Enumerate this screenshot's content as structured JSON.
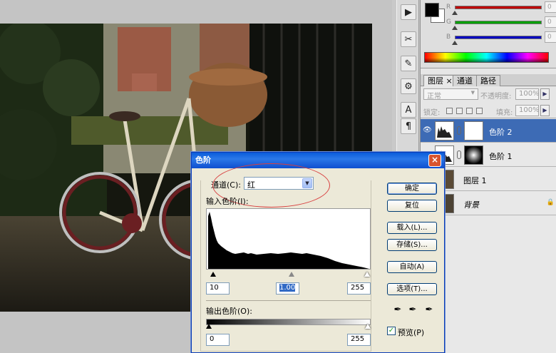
{
  "color_panel": {
    "foreground": "#000000",
    "background": "#ffffff",
    "sliders": [
      {
        "letter": "R",
        "value": "0",
        "color": "#c00000"
      },
      {
        "letter": "G",
        "value": "0",
        "color": "#00a000"
      },
      {
        "letter": "B",
        "value": "0",
        "color": "#0000c0"
      }
    ]
  },
  "layers_panel": {
    "tabs": [
      {
        "label": "图层",
        "close": "×"
      },
      {
        "label": "通道"
      },
      {
        "label": "路径"
      }
    ],
    "blend_mode": "正常",
    "opacity_label": "不透明度:",
    "opacity_value": "100%",
    "lock_label": "锁定:",
    "fill_label": "填充:",
    "fill_value": "100%",
    "layers": [
      {
        "name": "色阶 2",
        "selected": true
      },
      {
        "name": "色阶 1",
        "selected": false
      },
      {
        "name": "图层 1",
        "selected": false
      },
      {
        "name": "背景",
        "selected": false,
        "locked": true
      }
    ]
  },
  "dialog": {
    "title": "色阶",
    "close": "×",
    "channel_label": "通道(C):",
    "channel_value": "红",
    "input_levels_label": "输入色阶(I):",
    "input_black": "10",
    "input_gamma": "1.00",
    "input_white": "255",
    "output_levels_label": "输出色阶(O):",
    "output_black": "0",
    "output_white": "255",
    "buttons": {
      "ok": "确定",
      "reset": "复位",
      "load": "载入(L)...",
      "save": "存储(S)...",
      "auto": "自动(A)",
      "options": "选项(T)..."
    },
    "preview_label": "预览(P)",
    "preview_checked": true,
    "preview_check_glyph": "✓"
  },
  "icons": {
    "close": "close-icon",
    "eye": "eye-icon",
    "dropdown": "chevron-down-icon",
    "eyedropper": "eyedropper-icon"
  }
}
